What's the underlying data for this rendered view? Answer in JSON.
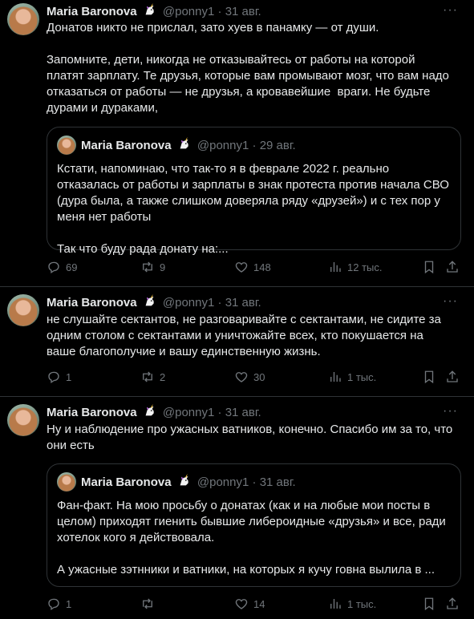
{
  "tweets": [
    {
      "name": "Maria Baronova",
      "handle": "@ponny1",
      "dot": "·",
      "date": "31 авг.",
      "text": "Донатов никто не прислал, зато хуев в панамку — от души.\n\nЗапомните, дети, никогда не отказывайтесь от работы на которой платят зарплату. Те друзья, которые вам промывают мозг, что вам надо отказаться от работы — не друзья, а кровавейшие  враги. Не будьте дурами и дураками,",
      "quote": {
        "name": "Maria Baronova",
        "handle": "@ponny1",
        "dot": "·",
        "date": "29 авг.",
        "text": "Кстати, напоминаю, что так-то я в феврале 2022 г. реально отказалась от работы и зарплаты в знак протеста против начала СВО (дура была, а также слишком доверяла ряду «друзей») и с тех пор у меня нет работы\n\nТак что буду рада донату на:..."
      },
      "stats": {
        "replies": "69",
        "reposts": "9",
        "likes": "148",
        "views": "12 тыс."
      }
    },
    {
      "name": "Maria Baronova",
      "handle": "@ponny1",
      "dot": "·",
      "date": "31 авг.",
      "text": "не слушайте сектантов, не разговаривайте с сектантами, не сидите за одним столом с сектантами и уничтожайте всех, кто покушается на ваше благополучие и вашу единственную жизнь.",
      "stats": {
        "replies": "1",
        "reposts": "2",
        "likes": "30",
        "views": "1 тыс."
      }
    },
    {
      "name": "Maria Baronova",
      "handle": "@ponny1",
      "dot": "·",
      "date": "31 авг.",
      "text": "Ну и наблюдение про ужасных ватников, конечно. Спасибо им за то, что они есть",
      "quote": {
        "name": "Maria Baronova",
        "handle": "@ponny1",
        "dot": "·",
        "date": "31 авг.",
        "text": "Фан-факт. На мою просьбу о донатах (как и на любые мои посты в целом) приходят гиенить бывшие либероидные «друзья» и все, ради хотелок кого я действовала.\n\nА ужасные зэтнники и ватники, на которых я кучу говна вылила в ..."
      },
      "stats": {
        "replies": "1",
        "reposts": "",
        "likes": "14",
        "views": "1 тыс."
      }
    }
  ],
  "icons": {
    "reply": "reply-icon",
    "repost": "repost-icon",
    "like": "heart-icon",
    "views": "views-icon",
    "bookmark": "bookmark-icon",
    "share": "share-icon",
    "more": "more-icon",
    "unicorn": "unicorn-emoji-icon"
  },
  "colors": {
    "background": "#000000",
    "text": "#e7e9ea",
    "muted": "#71767b",
    "border": "#2f3336"
  }
}
